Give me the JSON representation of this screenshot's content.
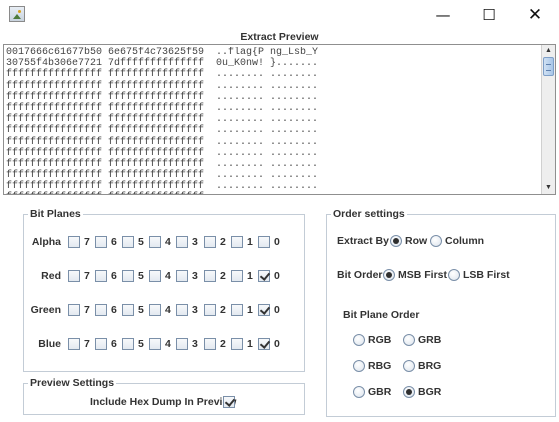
{
  "window": {
    "icon": "java-app-icon",
    "controls": {
      "minimize": "—",
      "maximize": "☐",
      "close": "✕"
    }
  },
  "preview": {
    "label": "Extract Preview",
    "lines": [
      "0017666c61677b50 6e675f4c73625f59  ..flag{P ng_Lsb_Y",
      "30755f4b306e7721 7dffffffffffffff  0u_K0nw! }.......",
      "ffffffffffffffff ffffffffffffffff  ........ ........",
      "ffffffffffffffff ffffffffffffffff  ........ ........",
      "ffffffffffffffff ffffffffffffffff  ........ ........",
      "ffffffffffffffff ffffffffffffffff  ........ ........",
      "ffffffffffffffff ffffffffffffffff  ........ ........",
      "ffffffffffffffff ffffffffffffffff  ........ ........",
      "ffffffffffffffff ffffffffffffffff  ........ ........",
      "ffffffffffffffff ffffffffffffffff  ........ ........",
      "ffffffffffffffff ffffffffffffffff  ........ ........",
      "ffffffffffffffff ffffffffffffffff  ........ ........",
      "ffffffffffffffff ffffffffffffffff  ........ ........",
      "ffffffffffffffff ffffffffffffffff  ........ ........"
    ]
  },
  "bit_planes": {
    "title": "Bit Planes",
    "rows": [
      {
        "label": "Alpha",
        "checked": []
      },
      {
        "label": "Red",
        "checked": [
          "0"
        ]
      },
      {
        "label": "Green",
        "checked": [
          "0"
        ]
      },
      {
        "label": "Blue",
        "checked": [
          "0"
        ]
      }
    ],
    "bits": [
      "7",
      "6",
      "5",
      "4",
      "3",
      "2",
      "1",
      "0"
    ]
  },
  "preview_settings": {
    "title": "Preview Settings",
    "hex_dump_label": "Include Hex Dump In Preview",
    "hex_dump_checked": true
  },
  "order_settings": {
    "title": "Order settings",
    "extract_by_label": "Extract By",
    "extract_by_options": [
      "Row",
      "Column"
    ],
    "extract_by_selected": "Row",
    "bit_order_label": "Bit Order",
    "bit_order_options": [
      "MSB First",
      "LSB First"
    ],
    "bit_order_selected": "MSB First",
    "plane_order_label": "Bit Plane Order",
    "plane_order_options": [
      "RGB",
      "GRB",
      "RBG",
      "BRG",
      "GBR",
      "BGR"
    ],
    "plane_order_selected": "BGR"
  }
}
